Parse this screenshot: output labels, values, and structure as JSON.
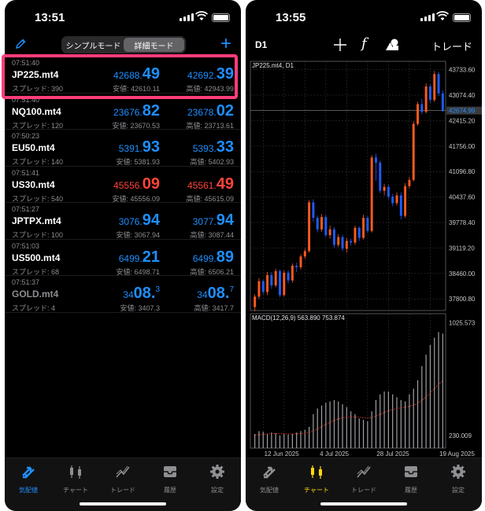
{
  "left": {
    "status_time": "13:51",
    "segment": {
      "simple": "シンプルモード",
      "detail": "詳細モード"
    },
    "plus": "+",
    "quotes": [
      {
        "time": "07:51:40",
        "symbol": "JP225.mt4",
        "spread": "スプレッド: 390",
        "bid_pre": "42688.",
        "bid_big": "49",
        "bid_sup": "",
        "ask_pre": "42692.",
        "ask_big": "39",
        "ask_sup": "",
        "low": "安値: 42610.11",
        "high": "高値: 42943.99"
      },
      {
        "time": "07:51:40",
        "symbol": "NQ100.mt4",
        "spread": "スプレッド: 120",
        "bid_pre": "23676.",
        "bid_big": "82",
        "bid_sup": "",
        "ask_pre": "23678.",
        "ask_big": "02",
        "ask_sup": "",
        "low": "安値: 23670.53",
        "high": "高値: 23713.61"
      },
      {
        "time": "07:50:23",
        "symbol": "EU50.mt4",
        "spread": "スプレッド: 140",
        "bid_pre": "5391.",
        "bid_big": "93",
        "bid_sup": "",
        "ask_pre": "5393.",
        "ask_big": "33",
        "ask_sup": "",
        "low": "安値: 5381.93",
        "high": "高値: 5402.93"
      },
      {
        "time": "07:51:41",
        "symbol": "US30.mt4",
        "spread": "スプレッド: 540",
        "bid_pre": "45556.",
        "bid_big": "09",
        "bid_sup": "",
        "ask_pre": "45561.",
        "ask_big": "49",
        "ask_sup": "",
        "low": "安値: 45556.09",
        "high": "高値: 45615.09"
      },
      {
        "time": "07:51:27",
        "symbol": "JPTPX.mt4",
        "spread": "スプレッド: 100",
        "bid_pre": "3076.",
        "bid_big": "94",
        "bid_sup": "",
        "ask_pre": "3077.",
        "ask_big": "94",
        "ask_sup": "",
        "low": "安値: 3067.94",
        "high": "高値: 3087.44"
      },
      {
        "time": "07:51:03",
        "symbol": "US500.mt4",
        "spread": "スプレッド: 68",
        "bid_pre": "6499.",
        "bid_big": "21",
        "bid_sup": "",
        "ask_pre": "6499.",
        "ask_big": "89",
        "ask_sup": "",
        "low": "安値: 6498.71",
        "high": "高値: 6506.21"
      },
      {
        "time": "07:51:37",
        "symbol": "GOLD.mt4",
        "spread": "スプレッド: 4",
        "bid_pre": "34",
        "bid_big": "08.",
        "bid_sup": "3",
        "ask_pre": "34",
        "ask_big": "08.",
        "ask_sup": "7",
        "low": "安値: 3407.3",
        "high": "高値: 3417.7"
      }
    ],
    "row_styles": [
      "",
      "",
      "",
      "red",
      "",
      "",
      "gray"
    ],
    "tabs": [
      "気配値",
      "チャート",
      "トレード",
      "履歴",
      "設定"
    ]
  },
  "right": {
    "status_time": "13:55",
    "symbol": "D1",
    "fx": "f",
    "trade_label": "トレード",
    "tabs": [
      "気配値",
      "チャート",
      "トレード",
      "履歴",
      "設定"
    ]
  },
  "colors": {
    "accent": "#1e8fff",
    "down": "#ff453a",
    "highlight": "#ff3d7b",
    "active_chart_tab": "#ffd60a"
  },
  "chart_data": {
    "type": "candlestick",
    "title": "JP225.mt4, D1",
    "current_price_label": "42674.99",
    "current_price": 42674.99,
    "y_ticks": [
      "43733.60",
      "43074.40",
      "42415.20",
      "41756.00",
      "41096.80",
      "40437.60",
      "39778.40",
      "39119.20",
      "38460.00",
      "37800.80"
    ],
    "ylim": [
      37500,
      43950
    ],
    "x_ticks": [
      "12 Jun 2025",
      "4 Jul 2025",
      "28 Jul 2025",
      "19 Aug 2025"
    ],
    "candles": [
      [
        37590,
        37860,
        37480,
        37920
      ],
      [
        37860,
        38260,
        37800,
        38340
      ],
      [
        38260,
        37980,
        37920,
        38300
      ],
      [
        37980,
        38420,
        37900,
        38500
      ],
      [
        38420,
        38150,
        38060,
        38500
      ],
      [
        38150,
        38520,
        38100,
        38580
      ],
      [
        38520,
        37900,
        37850,
        38560
      ],
      [
        37900,
        38480,
        37860,
        38540
      ],
      [
        38480,
        38280,
        38200,
        38540
      ],
      [
        38280,
        38660,
        38220,
        38720
      ],
      [
        38660,
        38620,
        38500,
        38740
      ],
      [
        38620,
        38900,
        38560,
        38960
      ],
      [
        38900,
        39040,
        38840,
        39100
      ],
      [
        39040,
        40300,
        39000,
        40360
      ],
      [
        40300,
        39900,
        39800,
        40380
      ],
      [
        39900,
        39600,
        39520,
        39960
      ],
      [
        39600,
        39920,
        39540,
        40000
      ],
      [
        39920,
        39450,
        39400,
        39980
      ],
      [
        39450,
        39600,
        39360,
        39700
      ],
      [
        39600,
        39200,
        39120,
        39660
      ],
      [
        39200,
        39400,
        39140,
        39480
      ],
      [
        39400,
        39100,
        39040,
        39460
      ],
      [
        39100,
        39300,
        39000,
        39380
      ],
      [
        39300,
        39260,
        39180,
        39360
      ],
      [
        39260,
        39640,
        39200,
        39700
      ],
      [
        39640,
        39380,
        39300,
        39680
      ],
      [
        39380,
        39900,
        39340,
        39980
      ],
      [
        39900,
        39560,
        39500,
        39960
      ],
      [
        39560,
        41460,
        39520,
        41520
      ],
      [
        41460,
        41330,
        40860,
        41560
      ],
      [
        41330,
        40600,
        40540,
        41380
      ],
      [
        40600,
        40700,
        40480,
        40780
      ],
      [
        40700,
        40450,
        40380,
        40760
      ],
      [
        40450,
        40280,
        40200,
        40520
      ],
      [
        40280,
        40480,
        40220,
        40560
      ],
      [
        40480,
        39950,
        39860,
        40560
      ],
      [
        39950,
        40720,
        39900,
        40800
      ],
      [
        40720,
        40880,
        40660,
        40960
      ],
      [
        40880,
        42330,
        40840,
        42400
      ],
      [
        42330,
        42840,
        42280,
        42900
      ],
      [
        42840,
        42640,
        42580,
        42980
      ],
      [
        42640,
        43300,
        42600,
        43380
      ],
      [
        43300,
        42950,
        42880,
        43360
      ],
      [
        42950,
        43620,
        42900,
        43700
      ],
      [
        43620,
        43120,
        43050,
        43680
      ],
      [
        43120,
        42674.99,
        42640,
        43200
      ]
    ],
    "macd": {
      "label": "MACD(12,26,9) 563.890 753.874",
      "y_ticks": [
        "1025.573",
        "230.009"
      ],
      "ylim": [
        140,
        1090
      ],
      "histogram": [
        240,
        260,
        255,
        240,
        250,
        245,
        230,
        240,
        235,
        240,
        250,
        260,
        270,
        290,
        380,
        420,
        440,
        460,
        470,
        480,
        470,
        450,
        430,
        400,
        380,
        350,
        340,
        330,
        400,
        480,
        520,
        540,
        540,
        520,
        500,
        480,
        470,
        520,
        560,
        620,
        720,
        800,
        870,
        920,
        960,
        950
      ],
      "signal": [
        230,
        234,
        238,
        240,
        242,
        243,
        242,
        241,
        240,
        240,
        241,
        243,
        246,
        250,
        262,
        276,
        292,
        308,
        322,
        336,
        346,
        354,
        358,
        360,
        360,
        358,
        355,
        352,
        356,
        366,
        378,
        392,
        404,
        412,
        420,
        425,
        429,
        435,
        444,
        458,
        478,
        502,
        530,
        560,
        590,
        615
      ]
    }
  }
}
